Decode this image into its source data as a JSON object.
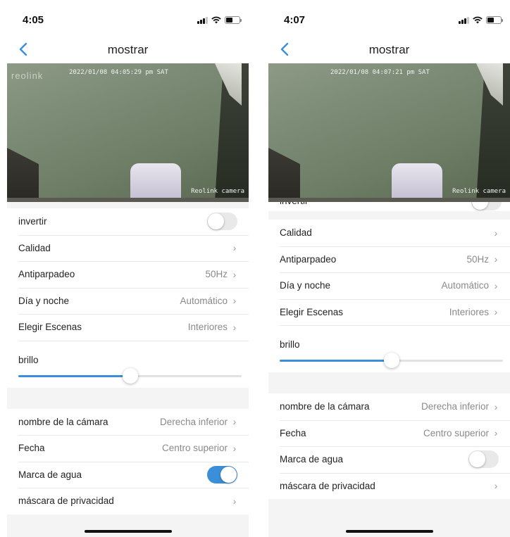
{
  "left": {
    "status_time": "4:05",
    "nav_title": "mostrar",
    "camera": {
      "logo": "reolink",
      "timestamp": "2022/01/08 04:05:29 pm SAT",
      "caption": "Reolink camera"
    },
    "settings_top": [
      {
        "label": "invertir",
        "type": "toggle",
        "on": false
      },
      {
        "label": "Calidad",
        "value": "",
        "type": "nav"
      },
      {
        "label": "Antiparpadeo",
        "value": "50Hz",
        "type": "nav"
      },
      {
        "label": "Día y noche",
        "value": "Automático",
        "type": "nav"
      },
      {
        "label": "Elegir Escenas",
        "value": "Interiores",
        "type": "nav"
      }
    ],
    "brightness": {
      "label": "brillo",
      "value": 0.5
    },
    "settings_bottom": [
      {
        "label": "nombre de la cámara",
        "value": "Derecha inferior",
        "type": "nav"
      },
      {
        "label": "Fecha",
        "value": "Centro superior",
        "type": "nav"
      },
      {
        "label": "Marca de agua",
        "type": "toggle",
        "on": true
      },
      {
        "label": "máscara de privacidad",
        "value": "",
        "type": "nav"
      }
    ]
  },
  "right": {
    "status_time": "4:07",
    "nav_title": "mostrar",
    "camera": {
      "logo": "",
      "timestamp": "2022/01/08 04:07:21 pm SAT",
      "caption": "Reolink camera"
    },
    "partial_row_label": "invertir",
    "settings_top": [
      {
        "label": "Calidad",
        "value": "",
        "type": "nav"
      },
      {
        "label": "Antiparpadeo",
        "value": "50Hz",
        "type": "nav"
      },
      {
        "label": "Día y noche",
        "value": "Automático",
        "type": "nav"
      },
      {
        "label": "Elegir Escenas",
        "value": "Interiores",
        "type": "nav"
      }
    ],
    "brightness": {
      "label": "brillo",
      "value": 0.5
    },
    "settings_bottom": [
      {
        "label": "nombre de la cámara",
        "value": "Derecha inferior",
        "type": "nav"
      },
      {
        "label": "Fecha",
        "value": "Centro superior",
        "type": "nav"
      },
      {
        "label": "Marca de agua",
        "type": "toggle",
        "on": false
      },
      {
        "label": "máscara de privacidad",
        "value": "",
        "type": "nav"
      }
    ]
  },
  "colors": {
    "accent": "#3b8fd8",
    "toggle_off": "#e9e9ea",
    "chevron": "#9a9a9a"
  },
  "icons": {
    "back": "chevron-left-icon",
    "row_nav": "chevron-right-icon",
    "signal": "cellular-signal-icon",
    "wifi": "wifi-icon",
    "battery": "battery-icon"
  }
}
